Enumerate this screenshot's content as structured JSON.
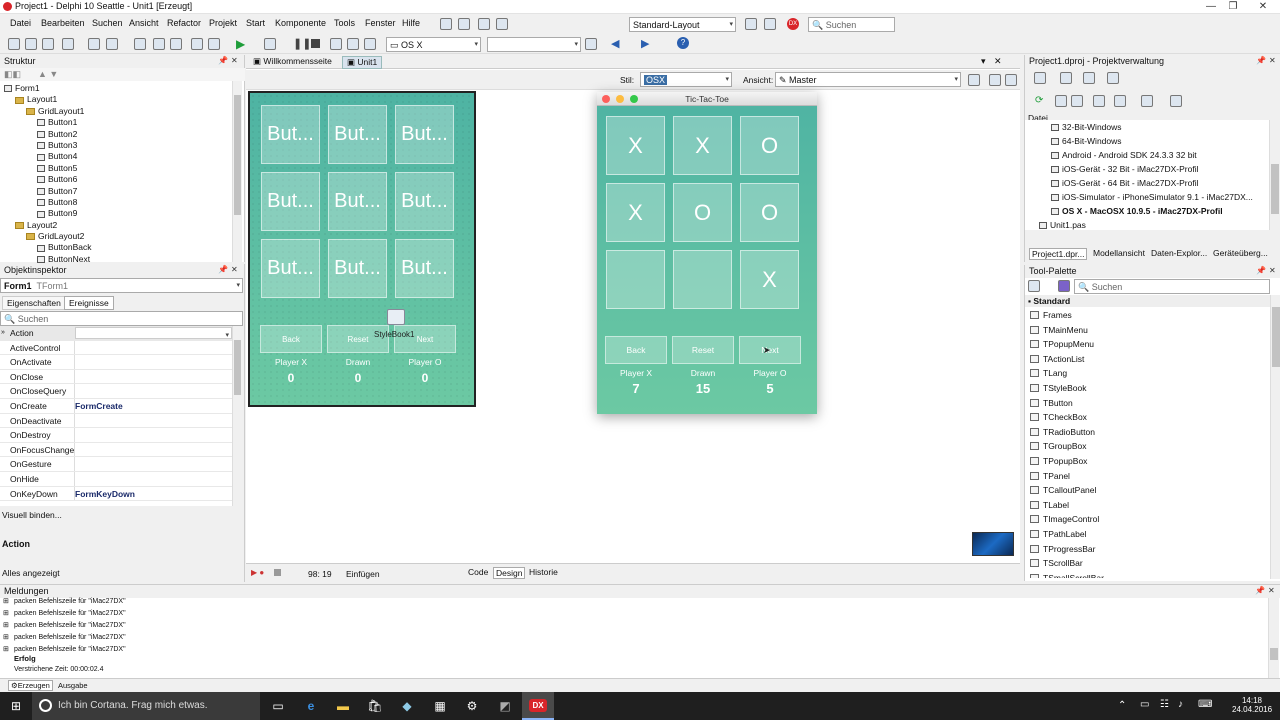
{
  "window": {
    "title": "Project1 - Delphi 10 Seattle - Unit1 [Erzeugt]"
  },
  "menu": [
    "Datei",
    "Bearbeiten",
    "Suchen",
    "Ansicht",
    "Refactor",
    "Projekt",
    "Start",
    "Komponente",
    "Tools",
    "Fenster",
    "Hilfe"
  ],
  "layout_combo": "Standard-Layout",
  "search_placeholder": "Suchen",
  "platform_combo": "OS X",
  "structure": {
    "title": "Struktur",
    "items": [
      {
        "label": "Form1",
        "indent": 0,
        "type": "form"
      },
      {
        "label": "Layout1",
        "indent": 1,
        "type": "folder"
      },
      {
        "label": "GridLayout1",
        "indent": 2,
        "type": "folder"
      },
      {
        "label": "Button1",
        "indent": 3,
        "type": "item"
      },
      {
        "label": "Button2",
        "indent": 3,
        "type": "item"
      },
      {
        "label": "Button3",
        "indent": 3,
        "type": "item"
      },
      {
        "label": "Button4",
        "indent": 3,
        "type": "item"
      },
      {
        "label": "Button5",
        "indent": 3,
        "type": "item"
      },
      {
        "label": "Button6",
        "indent": 3,
        "type": "item"
      },
      {
        "label": "Button7",
        "indent": 3,
        "type": "item"
      },
      {
        "label": "Button8",
        "indent": 3,
        "type": "item"
      },
      {
        "label": "Button9",
        "indent": 3,
        "type": "item"
      },
      {
        "label": "Layout2",
        "indent": 1,
        "type": "folder"
      },
      {
        "label": "GridLayout2",
        "indent": 2,
        "type": "folder"
      },
      {
        "label": "ButtonBack",
        "indent": 3,
        "type": "item"
      },
      {
        "label": "ButtonNext",
        "indent": 3,
        "type": "item"
      }
    ]
  },
  "inspector": {
    "title": "Objektinspektor",
    "object_name": "Form1",
    "object_type": "TForm1",
    "tabs": [
      "Eigenschaften",
      "Ereignisse"
    ],
    "search_placeholder": "Suchen",
    "group": "Action",
    "rows": [
      {
        "k": "ActiveControl",
        "v": ""
      },
      {
        "k": "OnActivate",
        "v": ""
      },
      {
        "k": "OnClose",
        "v": ""
      },
      {
        "k": "OnCloseQuery",
        "v": ""
      },
      {
        "k": "OnCreate",
        "v": "FormCreate"
      },
      {
        "k": "OnDeactivate",
        "v": ""
      },
      {
        "k": "OnDestroy",
        "v": ""
      },
      {
        "k": "OnFocusChange",
        "v": ""
      },
      {
        "k": "OnGesture",
        "v": ""
      },
      {
        "k": "OnHide",
        "v": ""
      },
      {
        "k": "OnKeyDown",
        "v": "FormKeyDown"
      }
    ],
    "link": "Visuell binden...",
    "desc_title": "Action",
    "status": "Alles angezeigt"
  },
  "editor": {
    "tabs": [
      "Willkommensseite",
      "Unit1"
    ],
    "style_label": "Stil:",
    "style_value": "OSX",
    "view_label": "Ansicht:",
    "view_value": "Master",
    "status": {
      "position": "98: 19",
      "mode": "Einfügen"
    },
    "bottom_tabs": [
      "Code",
      "Design",
      "Historie"
    ]
  },
  "designer": {
    "cells": [
      "But...",
      "But...",
      "But...",
      "But...",
      "But...",
      "But...",
      "But...",
      "But...",
      "But..."
    ],
    "buttons": [
      "Back",
      "Reset",
      "Next"
    ],
    "stylebook": "StyleBook1",
    "labels": [
      "Player X",
      "Drawn",
      "Player O"
    ],
    "scores": [
      "0",
      "0",
      "0"
    ]
  },
  "runtime": {
    "title": "Tic-Tac-Toe",
    "cells": [
      "X",
      "X",
      "O",
      "X",
      "O",
      "O",
      "",
      "",
      "X"
    ],
    "buttons": [
      "Back",
      "Reset",
      "Next"
    ],
    "labels": [
      "Player X",
      "Drawn",
      "Player O"
    ],
    "scores": [
      "7",
      "15",
      "5"
    ]
  },
  "project": {
    "title": "Project1.dproj - Projektverwaltung",
    "datei_label": "Datei",
    "items": [
      {
        "label": "32-Bit-Windows",
        "bold": false,
        "indent": 1
      },
      {
        "label": "64-Bit-Windows",
        "bold": false,
        "indent": 1
      },
      {
        "label": "Android - Android SDK 24.3.3 32 bit",
        "bold": false,
        "indent": 1
      },
      {
        "label": "iOS-Gerät - 32 Bit - iMac27DX-Profil",
        "bold": false,
        "indent": 1
      },
      {
        "label": "iOS-Gerät - 64 Bit - iMac27DX-Profil",
        "bold": false,
        "indent": 1
      },
      {
        "label": "iOS-Simulator - iPhoneSimulator 9.1 - iMac27DX...",
        "bold": false,
        "indent": 1
      },
      {
        "label": "OS X - MacOSX 10.9.5 - iMac27DX-Profil",
        "bold": true,
        "indent": 1
      },
      {
        "label": "Unit1.pas",
        "bold": false,
        "indent": 0
      }
    ],
    "tabs": [
      "Project1.dpr...",
      "Modellansicht",
      "Daten-Explor...",
      "Geräteüberg..."
    ]
  },
  "palette": {
    "title": "Tool-Palette",
    "search_placeholder": "Suchen",
    "category": "Standard",
    "items": [
      "Frames",
      "TMainMenu",
      "TPopupMenu",
      "TActionList",
      "TLang",
      "TStyleBook",
      "TButton",
      "TCheckBox",
      "TRadioButton",
      "TGroupBox",
      "TPopupBox",
      "TPanel",
      "TCalloutPanel",
      "TLabel",
      "TImageControl",
      "TPathLabel",
      "TProgressBar",
      "TScrollBar",
      "TSmallScrollBar"
    ]
  },
  "messages": {
    "title": "Meldungen",
    "lines": [
      "packen Befehlszeile für \"iMac27DX\"",
      "packen Befehlszeile für \"iMac27DX\"",
      "packen Befehlszeile für \"iMac27DX\"",
      "packen Befehlszeile für \"iMac27DX\"",
      "packen Befehlszeile für \"iMac27DX\""
    ],
    "success": "Erfolg",
    "elapsed": "Verstrichene Zeit: 00:00:02.4",
    "tabs": [
      "Erzeugen",
      "Ausgabe"
    ]
  },
  "taskbar": {
    "cortana": "Ich bin Cortana. Frag mich etwas.",
    "time": "14:18",
    "date": "24.04.2016"
  },
  "colors": {
    "teal_top": "#4eb3a3",
    "teal_bottom": "#6cc9a3",
    "accent": "#d9252a"
  }
}
